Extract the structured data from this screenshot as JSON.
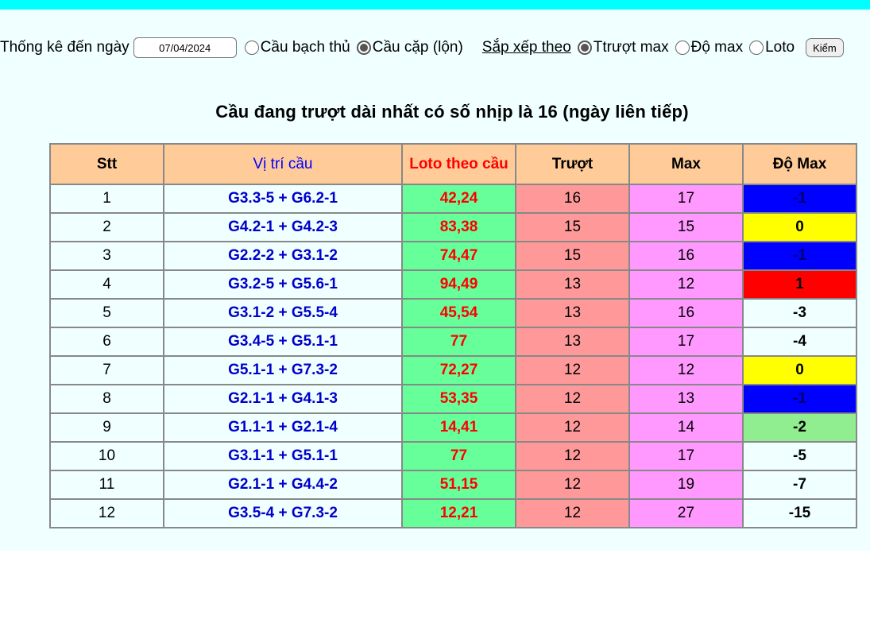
{
  "filters": {
    "date_label": "Thống kê đến ngày",
    "date_value": "07/04/2024",
    "mode_options": [
      {
        "label": "Cầu bạch thủ",
        "checked": false
      },
      {
        "label": "Cầu cặp (lộn)",
        "checked": true
      }
    ],
    "sort_label": "Sắp xếp theo",
    "sort_options": [
      {
        "label": "Ttrượt max",
        "checked": true
      },
      {
        "label": "Độ max",
        "checked": false
      },
      {
        "label": "Loto",
        "checked": false
      }
    ],
    "check_button": "Kiểm"
  },
  "heading": "Cầu đang trượt dài nhất có số nhịp là 16 (ngày liên tiếp)",
  "table": {
    "headers": [
      "Stt",
      "Vị trí cầu",
      "Loto theo cầu",
      "Trượt",
      "Max",
      "Độ Max"
    ],
    "rows": [
      {
        "stt": "1",
        "pos": "G3.3-5 + G6.2-1",
        "loto": "42,24",
        "truot": "16",
        "max": "17",
        "domax": "-1",
        "domax_bg": "#0000ff"
      },
      {
        "stt": "2",
        "pos": "G4.2-1 + G4.2-3",
        "loto": "83,38",
        "truot": "15",
        "max": "15",
        "domax": "0",
        "domax_bg": "#ffff00"
      },
      {
        "stt": "3",
        "pos": "G2.2-2 + G3.1-2",
        "loto": "74,47",
        "truot": "15",
        "max": "16",
        "domax": "-1",
        "domax_bg": "#0000ff"
      },
      {
        "stt": "4",
        "pos": "G3.2-5 + G5.6-1",
        "loto": "94,49",
        "truot": "13",
        "max": "12",
        "domax": "1",
        "domax_bg": "#ff0000"
      },
      {
        "stt": "5",
        "pos": "G3.1-2 + G5.5-4",
        "loto": "45,54",
        "truot": "13",
        "max": "16",
        "domax": "-3",
        "domax_bg": "#f0ffff"
      },
      {
        "stt": "6",
        "pos": "G3.4-5 + G5.1-1",
        "loto": "77",
        "truot": "13",
        "max": "17",
        "domax": "-4",
        "domax_bg": "#f0ffff"
      },
      {
        "stt": "7",
        "pos": "G5.1-1 + G7.3-2",
        "loto": "72,27",
        "truot": "12",
        "max": "12",
        "domax": "0",
        "domax_bg": "#ffff00"
      },
      {
        "stt": "8",
        "pos": "G2.1-1 + G4.1-3",
        "loto": "53,35",
        "truot": "12",
        "max": "13",
        "domax": "-1",
        "domax_bg": "#0000ff"
      },
      {
        "stt": "9",
        "pos": "G1.1-1 + G2.1-4",
        "loto": "14,41",
        "truot": "12",
        "max": "14",
        "domax": "-2",
        "domax_bg": "#90ee90"
      },
      {
        "stt": "10",
        "pos": "G3.1-1 + G5.1-1",
        "loto": "77",
        "truot": "12",
        "max": "17",
        "domax": "-5",
        "domax_bg": "#f0ffff"
      },
      {
        "stt": "11",
        "pos": "G2.1-1 + G4.4-2",
        "loto": "51,15",
        "truot": "12",
        "max": "19",
        "domax": "-7",
        "domax_bg": "#f0ffff"
      },
      {
        "stt": "12",
        "pos": "G3.5-4 + G7.3-2",
        "loto": "12,21",
        "truot": "12",
        "max": "27",
        "domax": "-15",
        "domax_bg": "#f0ffff"
      }
    ]
  },
  "colors": {
    "topbar": "#00ffff",
    "panel_bg": "#f0ffff",
    "header_bg": "#ffcc99",
    "loto_bg": "#66ff99",
    "truot_bg": "#ff9999",
    "max_bg": "#ff99ff"
  }
}
